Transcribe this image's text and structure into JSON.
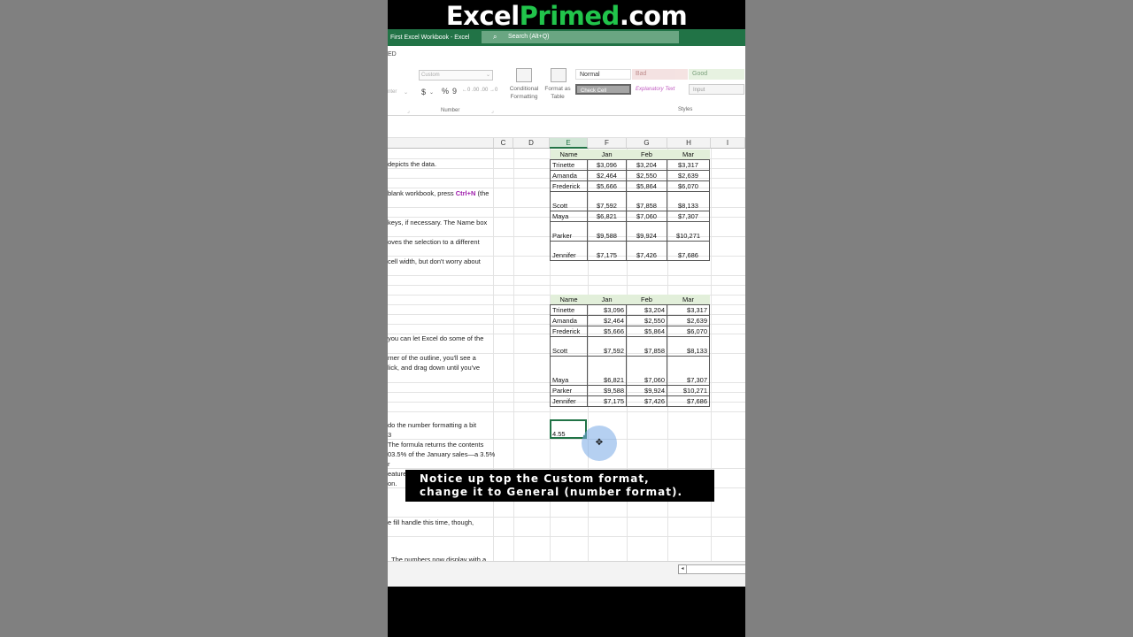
{
  "brand": {
    "part1": "Excel",
    "part2": "Primed",
    "part3": ".com"
  },
  "titlebar": {
    "workbook_title": "First Excel Workbook  -  Excel",
    "search_placeholder": "Search (Alt+Q)"
  },
  "ribbon": {
    "tab_fragment": "ED",
    "number_format_value": "Custom",
    "number_buttons": "$ ~ % 9",
    "center_fragment": "nter",
    "number_group_label": "Number",
    "conditional_formatting": "Conditional Formatting",
    "format_as_table": "Format as Table",
    "styles_group_label": "Styles",
    "styles": {
      "normal": "Normal",
      "bad": "Bad",
      "good": "Good",
      "check_cell": "Check Cell",
      "explanatory": "Explanatory Text",
      "input": "Input"
    }
  },
  "columns": [
    "C",
    "D",
    "E",
    "F",
    "G",
    "H",
    "I"
  ],
  "notes": [
    "depicts the data.",
    "blank workbook, press",
    "Ctrl+N",
    "(the",
    "keys, if necessary. The Name box",
    "oves the selection to a different",
    "cell width, but don't worry about",
    "you can let Excel do some of the",
    "rner of the outline, you'll see a",
    "lick, and drag down until you've",
    "do the number formatting a bit",
    "3",
    "The formula returns the contents",
    "03.5% of the January sales—a 3.5%",
    "r",
    "eature",
    "on.",
    "e fill handle this time, though,",
    ". The numbers now display with a"
  ],
  "table1": {
    "headers": [
      "Name",
      "Jan",
      "Feb",
      "Mar"
    ],
    "rows": [
      [
        "Trinette",
        "$3,096",
        "$3,204",
        "$3,317"
      ],
      [
        "Amanda",
        "$2,464",
        "$2,550",
        "$2,639"
      ],
      [
        "Frederick",
        "$5,666",
        "$5,864",
        "$6,070"
      ],
      [
        "Scott",
        "$7,592",
        "$7,858",
        "$8,133"
      ],
      [
        "Maya",
        "$6,821",
        "$7,060",
        "$7,307"
      ],
      [
        "Parker",
        "$9,588",
        "$9,924",
        "$10,271"
      ],
      [
        "Jennifer",
        "$7,175",
        "$7,426",
        "$7,686"
      ]
    ]
  },
  "table2": {
    "headers": [
      "Name",
      "Jan",
      "Feb",
      "Mar"
    ],
    "rows": [
      [
        "Trinette",
        "$3,096",
        "$3,204",
        "$3,317"
      ],
      [
        "Amanda",
        "$2,464",
        "$2,550",
        "$2,639"
      ],
      [
        "Frederick",
        "$5,666",
        "$5,864",
        "$6,070"
      ],
      [
        "Scott",
        "$7,592",
        "$7,858",
        "$8,133"
      ],
      [
        "Maya",
        "$6,821",
        "$7,060",
        "$7,307"
      ],
      [
        "Parker",
        "$9,588",
        "$9,924",
        "$10,271"
      ],
      [
        "Jennifer",
        "$7,175",
        "$7,426",
        "$7,686"
      ]
    ]
  },
  "selected_cell_value": "4.55",
  "caption": "Notice up top the Custom format, change it to General (number format).",
  "icons": {
    "search": "search-icon",
    "cursor": "crosshair-move-icon",
    "scroll_left": "scroll-left-icon"
  }
}
